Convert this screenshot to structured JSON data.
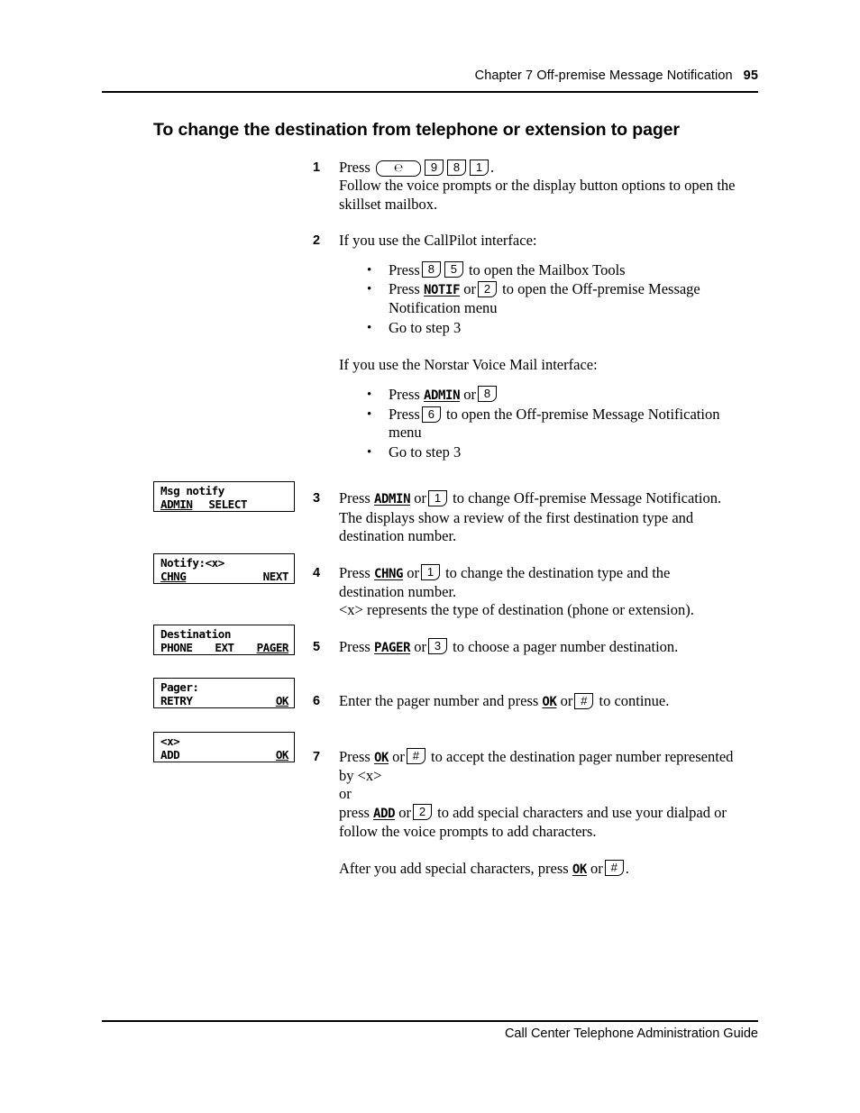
{
  "header": {
    "chapter": "Chapter 7  Off-premise Message Notification",
    "page_number": "95"
  },
  "footer": {
    "guide_title": "Call Center Telephone Administration Guide"
  },
  "section": {
    "title": "To change the destination from telephone or extension to pager"
  },
  "keys": {
    "feature": "℮",
    "nine": "9",
    "eight": "8",
    "one": "1",
    "two": "2",
    "three": "3",
    "five": "5",
    "six": "6",
    "pound": "#"
  },
  "softkeys": {
    "notif": "NOTIF",
    "admin": "ADMIN",
    "chng": "CHNG",
    "pager": "PAGER",
    "ok": "OK",
    "add": "ADD"
  },
  "steps": {
    "s1": {
      "num": "1",
      "press_label": "Press",
      "period": ".",
      "line2": "Follow the voice prompts or the display button options to open the",
      "line3": "skillset mailbox."
    },
    "s2": {
      "num": "2",
      "intro_callpilot": "If you use the CallPilot interface:",
      "b1_press": "Press",
      "b1_tail": "to open the Mailbox Tools",
      "b2_press": "Press",
      "b2_or": "or",
      "b2_tail": "to open the Off-premise Message",
      "b2_tail2": "Notification menu",
      "b3": "Go to step 3",
      "intro_norstar": "If you use the Norstar Voice Mail interface:",
      "n1_press": "Press",
      "n1_or": "or",
      "n2_press": "Press",
      "n2_tail": "to open the Off-premise Message Notification",
      "n2_tail2": "menu",
      "n3": "Go to step 3"
    },
    "s3": {
      "num": "3",
      "press": "Press",
      "or": "or",
      "tail": "to change Off-premise Message Notification.",
      "line2": "The displays show a review of the first destination type and",
      "line3": "destination number."
    },
    "s4": {
      "num": "4",
      "press": "Press",
      "or": "or",
      "tail": "to change the destination type and the",
      "line2": "destination number.",
      "line3": "<x> represents the type of destination (phone or extension)."
    },
    "s5": {
      "num": "5",
      "press": "Press",
      "or": "or",
      "tail": "to choose a pager number destination."
    },
    "s6": {
      "num": "6",
      "head": "Enter the pager number and press",
      "or": "or",
      "tail": "to continue."
    },
    "s7": {
      "num": "7",
      "press": "Press",
      "or": "or",
      "tail": "to accept the destination pager number represented",
      "line2": "by <x>",
      "line3": "or",
      "line4_press": "press",
      "line4_or": "or",
      "line4_tail": "to add special characters and use your dialpad or",
      "line5": "follow the voice prompts to add characters.",
      "line6_head": "After you add special characters, press",
      "line6_or": "or",
      "line6_tail": "."
    }
  },
  "displays": [
    {
      "name": "msg-notify",
      "line1": "Msg notify",
      "keys": [
        "ADMIN",
        "SELECT"
      ],
      "underlined": [
        "ADMIN"
      ]
    },
    {
      "name": "notify-x",
      "line1": "Notify:<x>",
      "keys": [
        "CHNG",
        "NEXT"
      ],
      "underlined": [
        "CHNG"
      ]
    },
    {
      "name": "destination",
      "line1": "Destination",
      "keys": [
        "PHONE",
        "EXT",
        "PAGER"
      ],
      "underlined": [
        "PAGER"
      ]
    },
    {
      "name": "pager-entry",
      "line1": "Pager:",
      "keys": [
        "RETRY",
        "OK"
      ],
      "underlined": [
        "OK"
      ]
    },
    {
      "name": "add-ok",
      "line1": "<x>",
      "keys": [
        "ADD",
        "OK"
      ],
      "underlined": [
        "OK"
      ]
    }
  ]
}
